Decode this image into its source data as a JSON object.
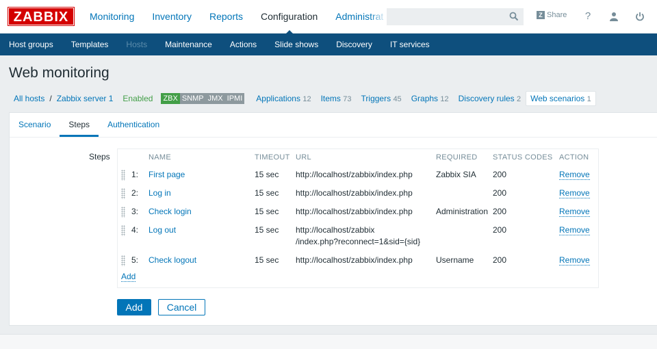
{
  "topbar": {
    "logo": "ZABBIX",
    "menu": [
      "Monitoring",
      "Inventory",
      "Reports",
      "Configuration",
      "Administrat"
    ],
    "active_menu": "Configuration",
    "search_value": "",
    "share_label": "Share"
  },
  "subnav": {
    "items": [
      "Host groups",
      "Templates",
      "Hosts",
      "Maintenance",
      "Actions",
      "Slide shows",
      "Discovery",
      "IT services"
    ],
    "active": "Hosts"
  },
  "page": {
    "title": "Web monitoring"
  },
  "hostnav": {
    "all_hosts": "All hosts",
    "host": "Zabbix server 1",
    "status": "Enabled",
    "availability": [
      "ZBX",
      "SNMP",
      "JMX",
      "IPMI"
    ],
    "links": [
      {
        "label": "Applications",
        "count": "12"
      },
      {
        "label": "Items",
        "count": "73"
      },
      {
        "label": "Triggers",
        "count": "45"
      },
      {
        "label": "Graphs",
        "count": "12"
      },
      {
        "label": "Discovery rules",
        "count": "2"
      },
      {
        "label": "Web scenarios",
        "count": "1"
      }
    ]
  },
  "form": {
    "tabs": [
      "Scenario",
      "Steps",
      "Authentication"
    ],
    "active_tab": "Steps",
    "steps_label": "Steps",
    "columns": [
      "NAME",
      "TIMEOUT",
      "URL",
      "REQUIRED",
      "STATUS CODES",
      "ACTION"
    ],
    "rows": [
      {
        "num": "1:",
        "name": "First page",
        "timeout": "15 sec",
        "url": "http://localhost/zabbix/index.php",
        "url2": "",
        "required": "Zabbix SIA",
        "status": "200",
        "action": "Remove"
      },
      {
        "num": "2:",
        "name": "Log in",
        "timeout": "15 sec",
        "url": "http://localhost/zabbix/index.php",
        "url2": "",
        "required": "",
        "status": "200",
        "action": "Remove"
      },
      {
        "num": "3:",
        "name": "Check login",
        "timeout": "15 sec",
        "url": "http://localhost/zabbix/index.php",
        "url2": "",
        "required": "Administration",
        "status": "200",
        "action": "Remove"
      },
      {
        "num": "4:",
        "name": "Log out",
        "timeout": "15 sec",
        "url": "http://localhost/zabbix",
        "url2": "/index.php?reconnect=1&sid={sid}",
        "required": "",
        "status": "200",
        "action": "Remove"
      },
      {
        "num": "5:",
        "name": "Check logout",
        "timeout": "15 sec",
        "url": "http://localhost/zabbix/index.php",
        "url2": "",
        "required": "Username",
        "status": "200",
        "action": "Remove"
      }
    ],
    "add_link": "Add",
    "add_button": "Add",
    "cancel_button": "Cancel"
  },
  "colors": {
    "brand": "#d40000",
    "nav": "#0e4f7d",
    "link": "#0275b8",
    "enabled": "#429e47"
  }
}
